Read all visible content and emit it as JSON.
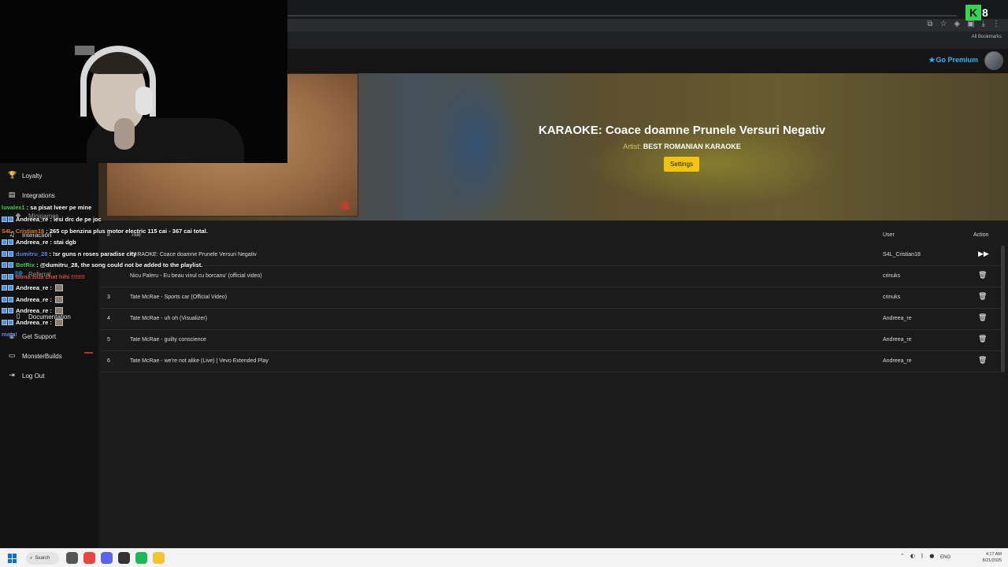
{
  "browser": {
    "bookmarks_label": "All Bookmarks",
    "extension_count": "8"
  },
  "header": {
    "premium_label": "Go Premium"
  },
  "now_playing": {
    "title": "KARAOKE: Coace doamne Prunele Versuri Negativ",
    "artist_label": "Artist:",
    "artist": "BEST ROMANIAN KARAOKE",
    "settings_label": "Settings"
  },
  "sidebar": {
    "items": [
      {
        "label": "Loyalty",
        "icon": "trophy-icon"
      },
      {
        "label": "Integrations",
        "icon": "integrations-icon"
      },
      {
        "label": "Minigames",
        "icon": "gamepad-icon"
      },
      {
        "label": "Interaction",
        "icon": "music-icon"
      },
      {
        "label": "Referral",
        "icon": "users-icon"
      },
      {
        "label": "Documentation",
        "icon": "document-icon"
      },
      {
        "label": "Get Support",
        "icon": "support-icon"
      },
      {
        "label": "MonsterBuilds",
        "icon": "monitor-icon"
      },
      {
        "label": "Log Out",
        "icon": "logout-icon"
      }
    ]
  },
  "queue": {
    "headers": {
      "num": "#",
      "title": "Title",
      "user": "User",
      "action": "Action"
    },
    "rows": [
      {
        "num": "",
        "title": "KARAOKE: Coace doamne Prunele Versuri Negativ",
        "user": "S4L_Cristian18",
        "action": "play"
      },
      {
        "num": "",
        "title": "Nicu Paleru - Eu beau vinul cu borcanu' (official video)",
        "user": "crinuks",
        "action": "delete"
      },
      {
        "num": "3",
        "title": "Tate McRae - Sports car (Official Video)",
        "user": "crinuks",
        "action": "delete"
      },
      {
        "num": "4",
        "title": "Tate McRae - uh oh (Visualizer)",
        "user": "Andreea_re",
        "action": "delete"
      },
      {
        "num": "5",
        "title": "Tate McRae - guilty conscience",
        "user": "Andreea_re",
        "action": "delete"
      },
      {
        "num": "6",
        "title": "Tate McRae - we're not alike (Live) | Vevo Extended Play",
        "user": "Andreea_re",
        "action": "delete"
      }
    ]
  },
  "chat": [
    {
      "user": "luvalex1",
      "color": "#39d353",
      "text": "sa pisat lveer pe mine",
      "badges": 0,
      "emote": false
    },
    {
      "user": "Andreea_re",
      "color": "#ffffff",
      "text": "iesi drc de pe joc",
      "badges": 2,
      "emote": false
    },
    {
      "user": "S4L_Cristian18",
      "color": "#e67e22",
      "text": "265 cp benzina plus motor electric 115 cai - 367 cai total.",
      "badges": 0,
      "emote": false
    },
    {
      "user": "Andreea_re",
      "color": "#ffffff",
      "text": "stai dgb",
      "badges": 2,
      "emote": false
    },
    {
      "user": "dumitru_28",
      "color": "#5b8def",
      "text": "!sr guns n roses paradise city",
      "badges": 2,
      "emote": false
    },
    {
      "user": "BotRix",
      "color": "#39d353",
      "text": "@dumitru_28, the song could not be added to the playlist.",
      "badges": 2,
      "emote": false
    },
    {
      "user": "",
      "color": "#e74c3c",
      "text": "Buna ziua chat hihi !!!!!!!",
      "badges": 2,
      "emote": false
    },
    {
      "user": "Andreea_re",
      "color": "#ffffff",
      "text": "",
      "badges": 2,
      "emote": true
    },
    {
      "user": "Andreea_re",
      "color": "#ffffff",
      "text": "",
      "badges": 2,
      "emote": true
    },
    {
      "user": "Andreea_re",
      "color": "#ffffff",
      "text": "",
      "badges": 2,
      "emote": true
    },
    {
      "user": "Andreea_re",
      "color": "#ffffff",
      "text": "",
      "badges": 2,
      "emote": true
    },
    {
      "user": "",
      "color": "#5b8def",
      "text": "mata!",
      "badges": 0,
      "emote": false
    }
  ],
  "taskbar": {
    "search_label": "Search",
    "language": "ENG",
    "time": "4:17 AM",
    "date": "8/21/2025"
  }
}
